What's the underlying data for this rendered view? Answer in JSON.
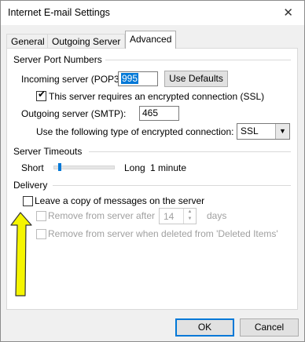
{
  "window": {
    "title": "Internet E-mail Settings",
    "close_glyph": "✕"
  },
  "tabs": [
    {
      "label": "General",
      "active": false
    },
    {
      "label": "Outgoing Server",
      "active": false
    },
    {
      "label": "Advanced",
      "active": true
    }
  ],
  "server_ports": {
    "heading": "Server Port Numbers",
    "incoming_label": "Incoming server (POP3):",
    "incoming_value": "995",
    "use_defaults_label": "Use Defaults",
    "ssl_checkbox_label": "This server requires an encrypted connection (SSL)",
    "ssl_checked": true,
    "outgoing_label": "Outgoing server (SMTP):",
    "outgoing_value": "465",
    "encryption_label": "Use the following type of encrypted connection:",
    "encryption_value": "SSL"
  },
  "timeouts": {
    "heading": "Server Timeouts",
    "short_label": "Short",
    "long_label": "Long",
    "value_text": "1 minute",
    "slider_fraction": 0.08
  },
  "delivery": {
    "heading": "Delivery",
    "leave_copy_label": "Leave a copy of messages on the server",
    "leave_copy_checked": false,
    "remove_after_label": "Remove from server after",
    "remove_after_days": "14",
    "days_label": "days",
    "remove_deleted_label": "Remove from server when deleted from 'Deleted Items'"
  },
  "footer": {
    "ok_label": "OK",
    "cancel_label": "Cancel"
  },
  "colors": {
    "annotation_arrow": "#f5f500",
    "accent": "#0078d7"
  },
  "icons": {
    "check": "✔",
    "dropdown": "▼",
    "spin_up": "▲",
    "spin_down": "▼"
  }
}
